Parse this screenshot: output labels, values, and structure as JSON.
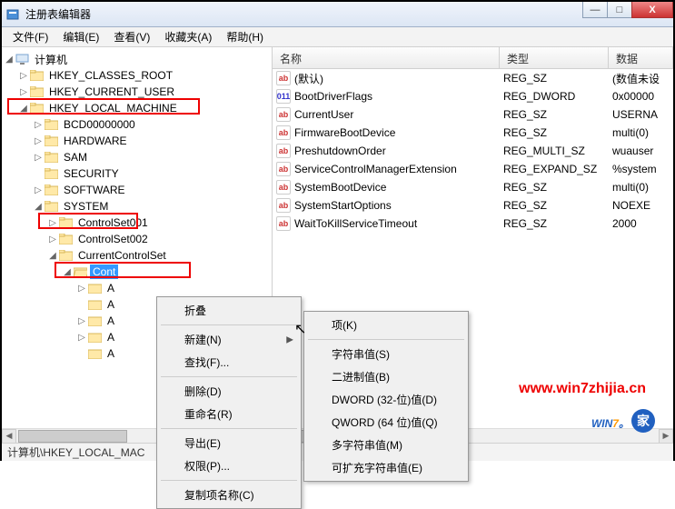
{
  "window": {
    "title": "注册表编辑器",
    "min": "—",
    "max": "□",
    "close": "X"
  },
  "menu": {
    "file": "文件(F)",
    "edit": "编辑(E)",
    "view": "查看(V)",
    "fav": "收藏夹(A)",
    "help": "帮助(H)"
  },
  "tree": {
    "root": "计算机",
    "hkcr": "HKEY_CLASSES_ROOT",
    "hkcu": "HKEY_CURRENT_USER",
    "hklm": "HKEY_LOCAL_MACHINE",
    "bcd": "BCD00000000",
    "hw": "HARDWARE",
    "sam": "SAM",
    "sec": "SECURITY",
    "sw": "SOFTWARE",
    "sys": "SYSTEM",
    "cs1": "ControlSet001",
    "cs2": "ControlSet002",
    "ccs": "CurrentControlSet",
    "ctrl": "Cont",
    "a1": "A",
    "a2": "A",
    "a3": "A",
    "a4": "A",
    "a5": "A"
  },
  "list": {
    "cols": {
      "name": "名称",
      "type": "类型",
      "data": "数据"
    },
    "rows": [
      {
        "icon": "ab",
        "name": "(默认)",
        "type": "REG_SZ",
        "data": "(数值未设"
      },
      {
        "icon": "bin",
        "name": "BootDriverFlags",
        "type": "REG_DWORD",
        "data": "0x00000"
      },
      {
        "icon": "ab",
        "name": "CurrentUser",
        "type": "REG_SZ",
        "data": "USERNA"
      },
      {
        "icon": "ab",
        "name": "FirmwareBootDevice",
        "type": "REG_SZ",
        "data": "multi(0)"
      },
      {
        "icon": "ab",
        "name": "PreshutdownOrder",
        "type": "REG_MULTI_SZ",
        "data": "wuauser"
      },
      {
        "icon": "ab",
        "name": "ServiceControlManagerExtension",
        "type": "REG_EXPAND_SZ",
        "data": "%system"
      },
      {
        "icon": "ab",
        "name": "SystemBootDevice",
        "type": "REG_SZ",
        "data": "multi(0)"
      },
      {
        "icon": "ab",
        "name": "SystemStartOptions",
        "type": "REG_SZ",
        "data": " NOEXE"
      },
      {
        "icon": "ab",
        "name": "WaitToKillServiceTimeout",
        "type": "REG_SZ",
        "data": "2000"
      }
    ]
  },
  "ctx1": {
    "collapse": "折叠",
    "new": "新建(N)",
    "find": "查找(F)...",
    "delete": "删除(D)",
    "rename": "重命名(R)",
    "export": "导出(E)",
    "perm": "权限(P)...",
    "copykey": "复制项名称(C)"
  },
  "ctx2": {
    "key": "项(K)",
    "string": "字符串值(S)",
    "binary": "二进制值(B)",
    "dword": "DWORD (32-位)值(D)",
    "qword": "QWORD (64 位)值(Q)",
    "multi": "多字符串值(M)",
    "expand": "可扩充字符串值(E)"
  },
  "status": "计算机\\HKEY_LOCAL_MAC",
  "watermark": {
    "url": "www.win7zhijia.cn",
    "logo_pre": "WIN",
    "logo_seven": "7",
    "logo_dot": "。",
    "logo_badge": "家"
  }
}
